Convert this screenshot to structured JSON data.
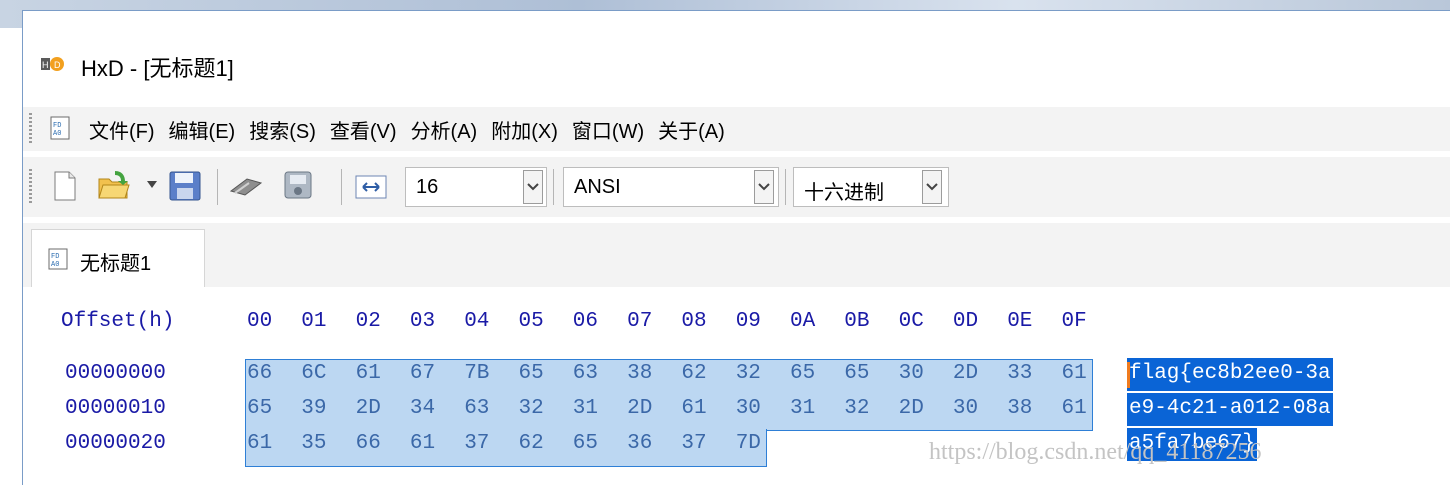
{
  "window": {
    "title": "HxD - [无标题1]",
    "app_icon": "hxd-app-icon"
  },
  "menu": {
    "items": [
      "文件(F)",
      "编辑(E)",
      "搜索(S)",
      "查看(V)",
      "分析(A)",
      "附加(X)",
      "窗口(W)",
      "关于(A)"
    ]
  },
  "toolbar": {
    "bytes_per_row": "16",
    "charset": "ANSI",
    "offset_base": "十六进制",
    "icons": [
      "new-file-icon",
      "open-file-icon",
      "save-icon",
      "ram-icon",
      "disk-icon",
      "columns-icon"
    ]
  },
  "tabs": [
    {
      "label": "无标题1"
    }
  ],
  "hex": {
    "offset_label": "Offset(h)",
    "columns": [
      "00",
      "01",
      "02",
      "03",
      "04",
      "05",
      "06",
      "07",
      "08",
      "09",
      "0A",
      "0B",
      "0C",
      "0D",
      "0E",
      "0F"
    ],
    "rows": [
      {
        "offset": "00000000",
        "bytes": [
          "66",
          "6C",
          "61",
          "67",
          "7B",
          "65",
          "63",
          "38",
          "62",
          "32",
          "65",
          "65",
          "30",
          "2D",
          "33",
          "61"
        ],
        "text": "flag{ec8b2ee0-3a"
      },
      {
        "offset": "00000010",
        "bytes": [
          "65",
          "39",
          "2D",
          "34",
          "63",
          "32",
          "31",
          "2D",
          "61",
          "30",
          "31",
          "32",
          "2D",
          "30",
          "38",
          "61"
        ],
        "text": "e9-4c21-a012-08a"
      },
      {
        "offset": "00000020",
        "bytes": [
          "61",
          "35",
          "66",
          "61",
          "37",
          "62",
          "65",
          "36",
          "37",
          "7D"
        ],
        "text": "a5fa7be67}"
      }
    ]
  },
  "watermark": "https://blog.csdn.net/qq_41187256"
}
